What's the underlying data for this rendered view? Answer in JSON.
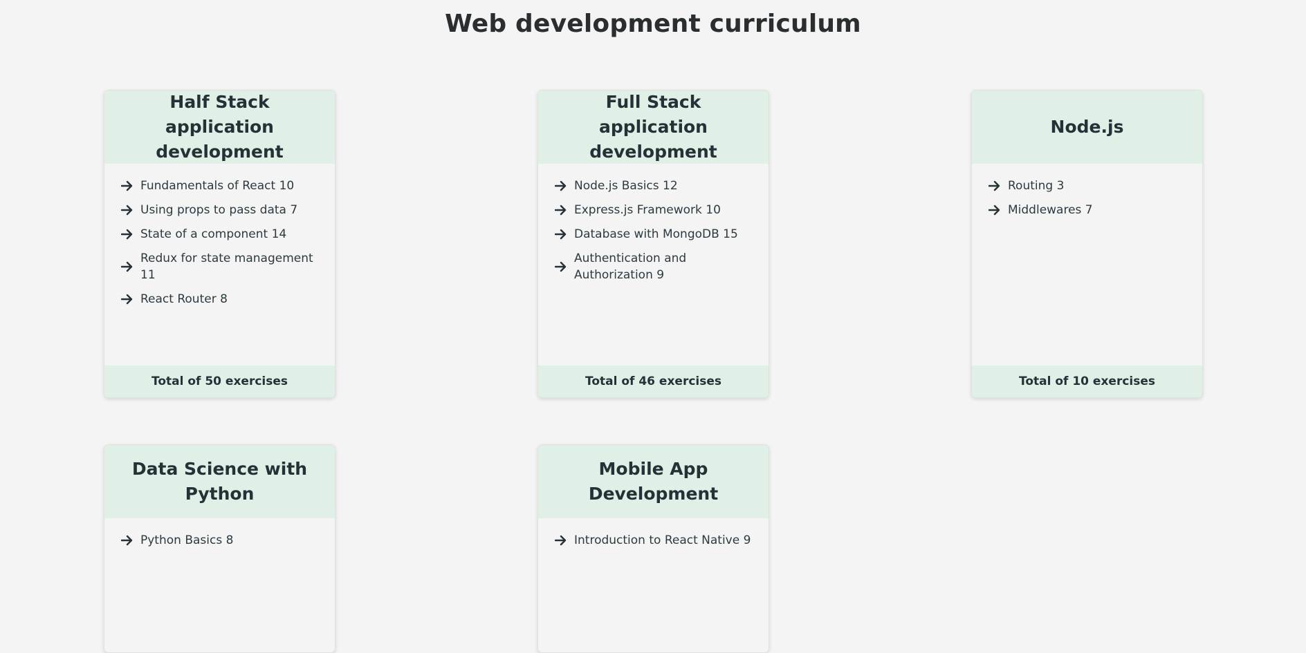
{
  "page": {
    "title": "Web development curriculum"
  },
  "courses": [
    {
      "title": "Half Stack application development",
      "parts": [
        {
          "label": "Fundamentals of React 10"
        },
        {
          "label": "Using props to pass data 7"
        },
        {
          "label": "State of a component 14"
        },
        {
          "label": "Redux for state management 11"
        },
        {
          "label": "React Router 8"
        }
      ],
      "total": "Total of 50 exercises"
    },
    {
      "title": "Full Stack application development",
      "parts": [
        {
          "label": "Node.js Basics 12"
        },
        {
          "label": "Express.js Framework 10"
        },
        {
          "label": "Database with MongoDB 15"
        },
        {
          "label": "Authentication and Authorization 9"
        }
      ],
      "total": "Total of 46 exercises"
    },
    {
      "title": "Node.js",
      "parts": [
        {
          "label": "Routing 3"
        },
        {
          "label": "Middlewares 7"
        }
      ],
      "total": "Total of 10 exercises"
    },
    {
      "title": "Data Science with Python",
      "parts": [
        {
          "label": "Python Basics 8"
        }
      ]
    },
    {
      "title": "Mobile App Development",
      "parts": [
        {
          "label": "Introduction to React Native 9"
        }
      ]
    }
  ],
  "icons": {
    "part_bullet": "arrow-right-icon"
  },
  "colors": {
    "background": "#f4f4f4",
    "card_header": "#e1f0e6",
    "text": "#243238"
  }
}
